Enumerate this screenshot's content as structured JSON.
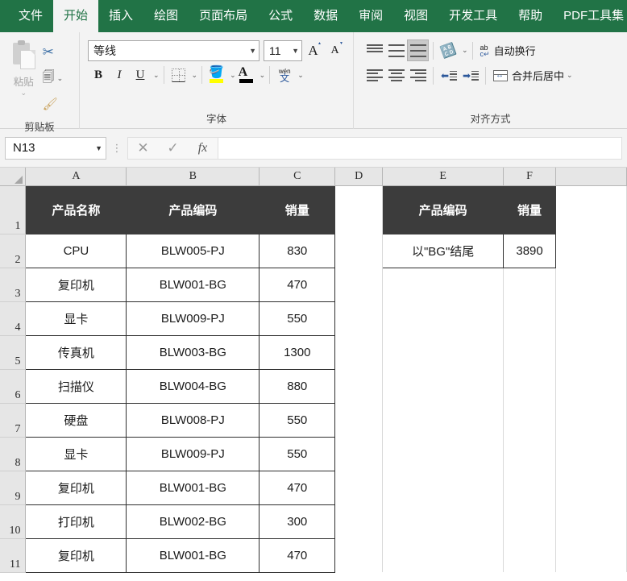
{
  "ribbon": {
    "tabs": [
      {
        "label": "文件",
        "active": false
      },
      {
        "label": "开始",
        "active": true
      },
      {
        "label": "插入",
        "active": false
      },
      {
        "label": "绘图",
        "active": false
      },
      {
        "label": "页面布局",
        "active": false
      },
      {
        "label": "公式",
        "active": false
      },
      {
        "label": "数据",
        "active": false
      },
      {
        "label": "审阅",
        "active": false
      },
      {
        "label": "视图",
        "active": false
      },
      {
        "label": "开发工具",
        "active": false
      },
      {
        "label": "帮助",
        "active": false
      },
      {
        "label": "PDF工具集",
        "active": false
      }
    ],
    "clipboard": {
      "group_label": "剪贴板",
      "paste_label": "粘贴",
      "cut_icon": "scissors-icon",
      "copy_icon": "copy-icon",
      "format_painter_icon": "format-painter-icon"
    },
    "font": {
      "group_label": "字体",
      "font_name": "等线",
      "font_size": "11",
      "bold": "B",
      "italic": "I",
      "underline": "U",
      "grow_font": "A",
      "shrink_font": "A",
      "phonetic_top": "wén",
      "phonetic_bottom": "文"
    },
    "alignment": {
      "group_label": "对齐方式",
      "wrap_text": "自动换行",
      "merge_center": "合并后居中",
      "wrap_icon_top": "ab",
      "wrap_icon_bottom": "c",
      "wrap_icon_arrow": "↵"
    }
  },
  "formula_bar": {
    "name_box": "N13",
    "cancel_icon": "✕",
    "confirm_icon": "✓",
    "function_icon": "fx",
    "formula_value": ""
  },
  "sheet": {
    "columns": [
      "A",
      "B",
      "C",
      "D",
      "E",
      "F"
    ],
    "rows": [
      "1",
      "2",
      "3",
      "4",
      "5",
      "6",
      "7",
      "8",
      "9",
      "10",
      "11"
    ],
    "left_table": {
      "headers": [
        "产品名称",
        "产品编码",
        "销量"
      ],
      "rows": [
        [
          "CPU",
          "BLW005-PJ",
          "830"
        ],
        [
          "复印机",
          "BLW001-BG",
          "470"
        ],
        [
          "显卡",
          "BLW009-PJ",
          "550"
        ],
        [
          "传真机",
          "BLW003-BG",
          "1300"
        ],
        [
          "扫描仪",
          "BLW004-BG",
          "880"
        ],
        [
          "硬盘",
          "BLW008-PJ",
          "550"
        ],
        [
          "显卡",
          "BLW009-PJ",
          "550"
        ],
        [
          "复印机",
          "BLW001-BG",
          "470"
        ],
        [
          "打印机",
          "BLW002-BG",
          "300"
        ],
        [
          "复印机",
          "BLW001-BG",
          "470"
        ]
      ]
    },
    "right_table": {
      "headers": [
        "产品编码",
        "销量"
      ],
      "rows": [
        [
          "以\"BG\"结尾",
          "3890"
        ]
      ]
    }
  },
  "colors": {
    "ribbon_green": "#217346",
    "header_dark": "#3c3c3c",
    "grid_header_gray": "#e6e6e6",
    "highlight_yellow": "#ffff00"
  }
}
